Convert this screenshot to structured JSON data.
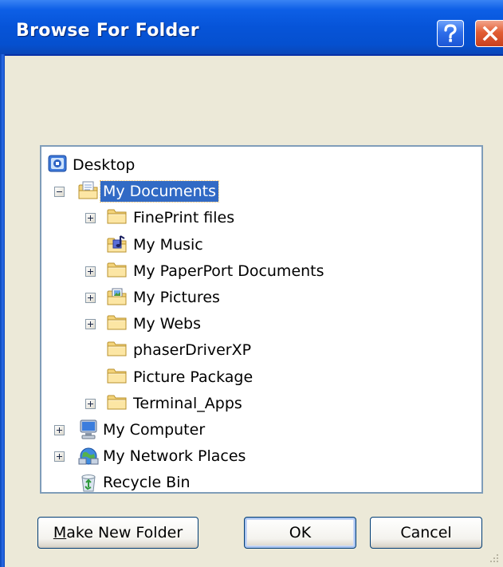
{
  "window": {
    "title": "Browse For Folder"
  },
  "titlebar_buttons": {
    "help_icon": "question-mark",
    "close_icon": "x-mark"
  },
  "tree": {
    "items": [
      {
        "label": "Desktop",
        "icon": "desktop-icon",
        "level": 0,
        "expander": "none",
        "selected": false
      },
      {
        "label": "My Documents",
        "icon": "my-documents-folder-icon",
        "level": 1,
        "expander": "minus",
        "selected": true
      },
      {
        "label": "FinePrint files",
        "icon": "folder-icon",
        "level": 2,
        "expander": "plus",
        "selected": false
      },
      {
        "label": "My Music",
        "icon": "music-folder-icon",
        "level": 2,
        "expander": "none",
        "selected": false
      },
      {
        "label": "My PaperPort Documents",
        "icon": "folder-icon",
        "level": 2,
        "expander": "plus",
        "selected": false
      },
      {
        "label": "My Pictures",
        "icon": "pictures-folder-icon",
        "level": 2,
        "expander": "plus",
        "selected": false
      },
      {
        "label": "My Webs",
        "icon": "folder-icon",
        "level": 2,
        "expander": "plus",
        "selected": false
      },
      {
        "label": "phaserDriverXP",
        "icon": "folder-icon",
        "level": 2,
        "expander": "none",
        "selected": false
      },
      {
        "label": "Picture Package",
        "icon": "folder-icon",
        "level": 2,
        "expander": "none",
        "selected": false
      },
      {
        "label": "Terminal_Apps",
        "icon": "folder-icon",
        "level": 2,
        "expander": "plus",
        "selected": false
      },
      {
        "label": "My Computer",
        "icon": "computer-icon",
        "level": 1,
        "expander": "plus",
        "selected": false
      },
      {
        "label": "My Network Places",
        "icon": "network-places-icon",
        "level": 1,
        "expander": "plus",
        "selected": false
      },
      {
        "label": "Recycle Bin",
        "icon": "recycle-bin-icon",
        "level": 1,
        "expander": "none",
        "selected": false
      }
    ]
  },
  "buttons": {
    "make_new_folder_prefix": "M",
    "make_new_folder_rest": "ake New Folder",
    "ok": "OK",
    "cancel": "Cancel"
  },
  "colors": {
    "titlebar": "#0654D8",
    "dialog_bg": "#ECE9D8",
    "selection": "#316AC5",
    "tree_border": "#7F9DB9"
  }
}
